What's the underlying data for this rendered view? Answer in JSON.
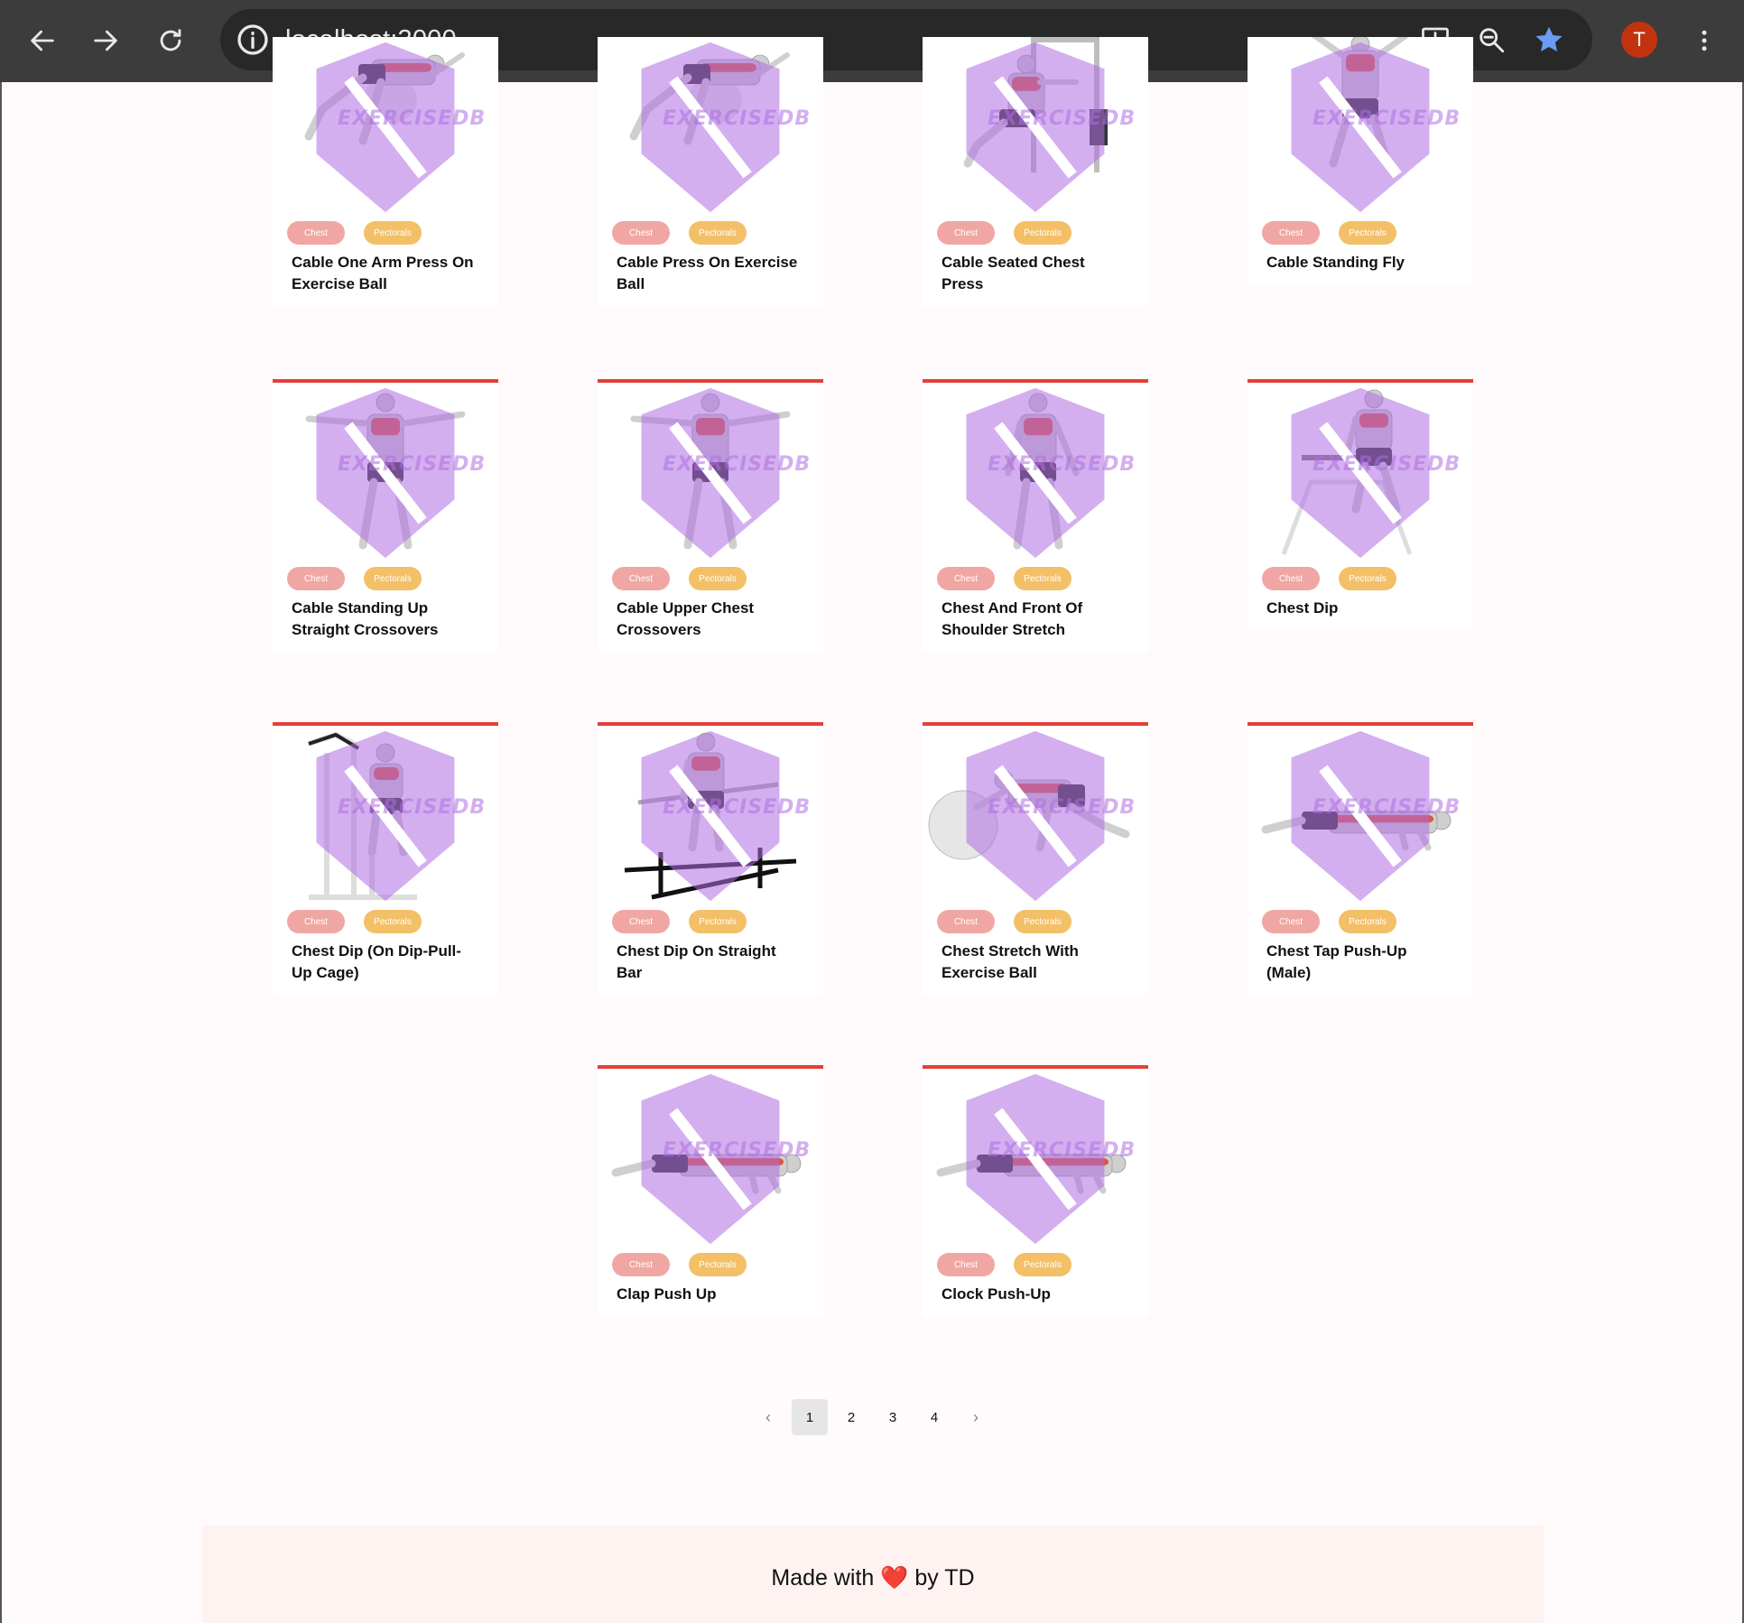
{
  "browser": {
    "url": "localhost:3000",
    "avatar_letter": "T",
    "accent": "#3c3c3c"
  },
  "exercises": [
    {
      "name": "Cable One Arm Press On Exercise Ball",
      "body_part": "Chest",
      "target": "Pectorals"
    },
    {
      "name": "Cable Press On Exercise Ball",
      "body_part": "Chest",
      "target": "Pectorals"
    },
    {
      "name": "Cable Seated Chest Press",
      "body_part": "Chest",
      "target": "Pectorals"
    },
    {
      "name": "Cable Standing Fly",
      "body_part": "Chest",
      "target": "Pectorals"
    },
    {
      "name": "Cable Standing Up Straight Crossovers",
      "body_part": "Chest",
      "target": "Pectorals"
    },
    {
      "name": "Cable Upper Chest Crossovers",
      "body_part": "Chest",
      "target": "Pectorals"
    },
    {
      "name": "Chest And Front Of Shoulder Stretch",
      "body_part": "Chest",
      "target": "Pectorals"
    },
    {
      "name": "Chest Dip",
      "body_part": "Chest",
      "target": "Pectorals"
    },
    {
      "name": "Chest Dip (On Dip-Pull-Up Cage)",
      "body_part": "Chest",
      "target": "Pectorals"
    },
    {
      "name": "Chest Dip On Straight Bar",
      "body_part": "Chest",
      "target": "Pectorals"
    },
    {
      "name": "Chest Stretch With Exercise Ball",
      "body_part": "Chest",
      "target": "Pectorals"
    },
    {
      "name": "Chest Tap Push-Up (Male)",
      "body_part": "Chest",
      "target": "Pectorals"
    },
    {
      "name": "Clap Push Up",
      "body_part": "Chest",
      "target": "Pectorals"
    },
    {
      "name": "Clock Push-Up",
      "body_part": "Chest",
      "target": "Pectorals"
    }
  ],
  "watermark": "EXERCISEDB",
  "pagination": {
    "pages": [
      "1",
      "2",
      "3",
      "4"
    ],
    "current": "1",
    "prev": "‹",
    "next": "›"
  },
  "footer": {
    "text_before": "Made with",
    "heart": "❤️",
    "text_after": "by TD"
  },
  "colors": {
    "card_top_border": "#e2403a",
    "body_part_tag": "#f0a7a3",
    "target_tag": "#f3c067"
  }
}
